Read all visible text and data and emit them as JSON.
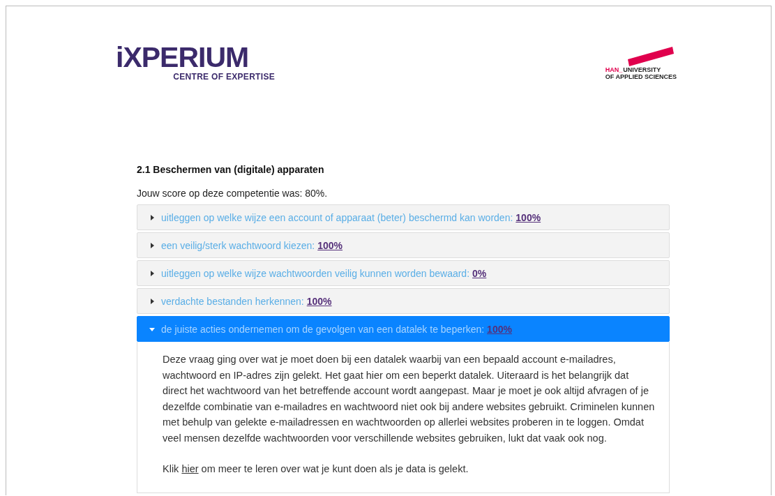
{
  "header": {
    "logo": {
      "name": "iXPERIUM",
      "tagline": "CENTRE OF EXPERTISE"
    },
    "partner_logo": {
      "prefix": "HAN_",
      "line_1": "UNIVERSITY",
      "line_2": "OF APPLIED SCIENCES"
    }
  },
  "competence": {
    "title": "2.1 Beschermen van (digitale) apparaten",
    "score_text": "Jouw score op deze competentie was: 80%.",
    "items": [
      {
        "label": "uitleggen op welke wijze een account of apparaat (beter) beschermd kan worden:",
        "score": "100%",
        "expanded": false
      },
      {
        "label": "een veilig/sterk wachtwoord kiezen:",
        "score": "100%",
        "expanded": false
      },
      {
        "label": "uitleggen op welke wijze wachtwoorden veilig kunnen worden bewaard:",
        "score": "0%",
        "expanded": false
      },
      {
        "label": "verdachte bestanden herkennen:",
        "score": "100%",
        "expanded": false
      },
      {
        "label": "de juiste acties ondernemen om de gevolgen van een datalek te beperken:",
        "score": "100%",
        "expanded": true,
        "explanation": "Deze vraag ging over wat je moet doen bij een datalek waarbij van een bepaald account e-mailadres, wachtwoord en IP-adres zijn gelekt. Het gaat hier om een beperkt datalek. Uiteraard is het belangrijk dat direct het wachtwoord van het betreffende account wordt aangepast. Maar je moet je ook altijd afvragen of je dezelfde combinatie van e-mailadres en wachtwoord niet ook bij andere websites gebruikt. Criminelen kunnen met behulp van gelekte e-mailadressen en wachtwoorden op allerlei websites proberen in te loggen. Omdat veel mensen dezelfde wachtwoorden voor verschillende websites gebruiken, lukt dat vaak ook nog.",
        "more": {
          "before": "Klik",
          "link": "hier",
          "after": "om meer te leren over wat je kunt doen als je data is gelekt."
        }
      }
    ]
  }
}
